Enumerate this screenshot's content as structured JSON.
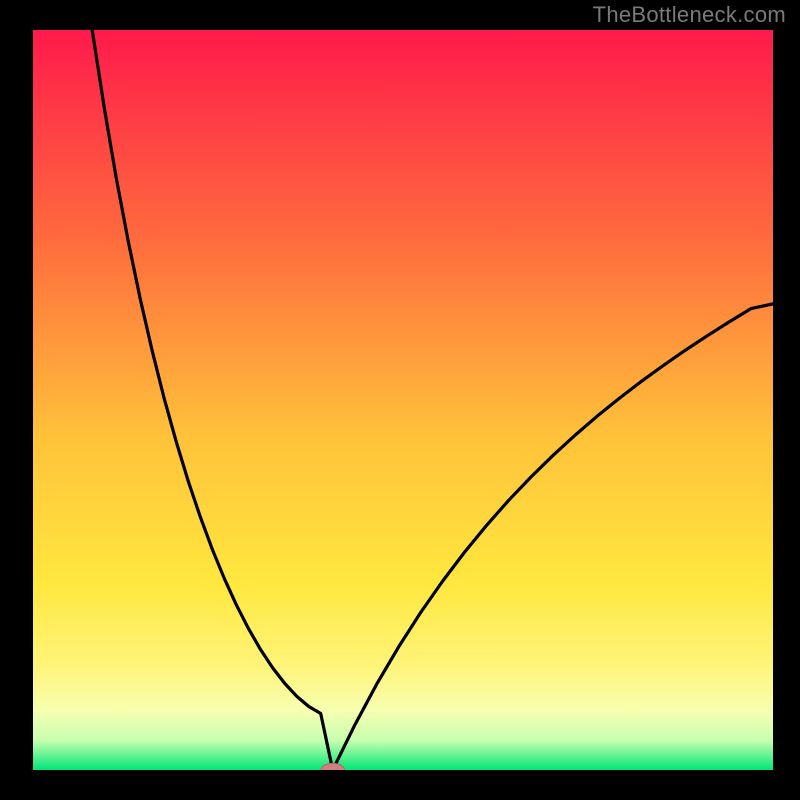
{
  "watermark": "TheBottleneck.com",
  "colors": {
    "background_black": "#000000",
    "gradient_top": "#ff1a4b",
    "gradient_uppermid": "#ff7a3c",
    "gradient_mid": "#ffd83d",
    "gradient_lowmid": "#fff47a",
    "gradient_lowlow": "#f3ffb8",
    "gradient_bottom": "#00e676",
    "curve": "#000000",
    "marker_fill": "#d08080",
    "marker_stroke": "#b06868",
    "watermark_text": "#7a7a7a"
  },
  "chart_data": {
    "type": "line",
    "title": "",
    "xlabel": "",
    "ylabel": "",
    "xlim": [
      0,
      100
    ],
    "ylim": [
      0,
      100
    ],
    "cusp_x": 40.5,
    "left_start": {
      "x": 8,
      "y": 100
    },
    "right_end": {
      "x": 100,
      "y": 63
    },
    "marker": {
      "x": 40.5,
      "y": 0,
      "rx": 1.6,
      "ry": 0.9
    },
    "series": [
      {
        "name": "left-branch",
        "x": [
          8.0,
          9.63,
          11.25,
          12.88,
          14.5,
          16.13,
          17.75,
          19.38,
          21.0,
          22.63,
          24.25,
          25.88,
          27.5,
          29.13,
          30.75,
          32.38,
          34.0,
          35.63,
          37.25,
          38.88,
          40.5
        ],
        "y": [
          100.0,
          89.49,
          80.0,
          71.41,
          63.62,
          56.55,
          50.12,
          44.28,
          38.97,
          34.14,
          29.77,
          25.82,
          22.27,
          19.09,
          16.28,
          13.82,
          11.72,
          9.97,
          8.6,
          7.63,
          0.0
        ]
      },
      {
        "name": "right-branch",
        "x": [
          40.5,
          43.48,
          46.45,
          49.43,
          52.4,
          55.38,
          58.35,
          61.33,
          64.3,
          67.28,
          70.25,
          73.23,
          76.2,
          79.18,
          82.15,
          85.13,
          88.1,
          91.08,
          94.05,
          97.03,
          100.0
        ],
        "y": [
          0.0,
          6.07,
          11.61,
          16.67,
          21.3,
          25.56,
          29.48,
          33.1,
          36.46,
          39.58,
          42.49,
          45.22,
          47.78,
          50.19,
          52.47,
          54.63,
          56.69,
          58.66,
          60.54,
          62.35,
          63.0
        ]
      }
    ]
  }
}
